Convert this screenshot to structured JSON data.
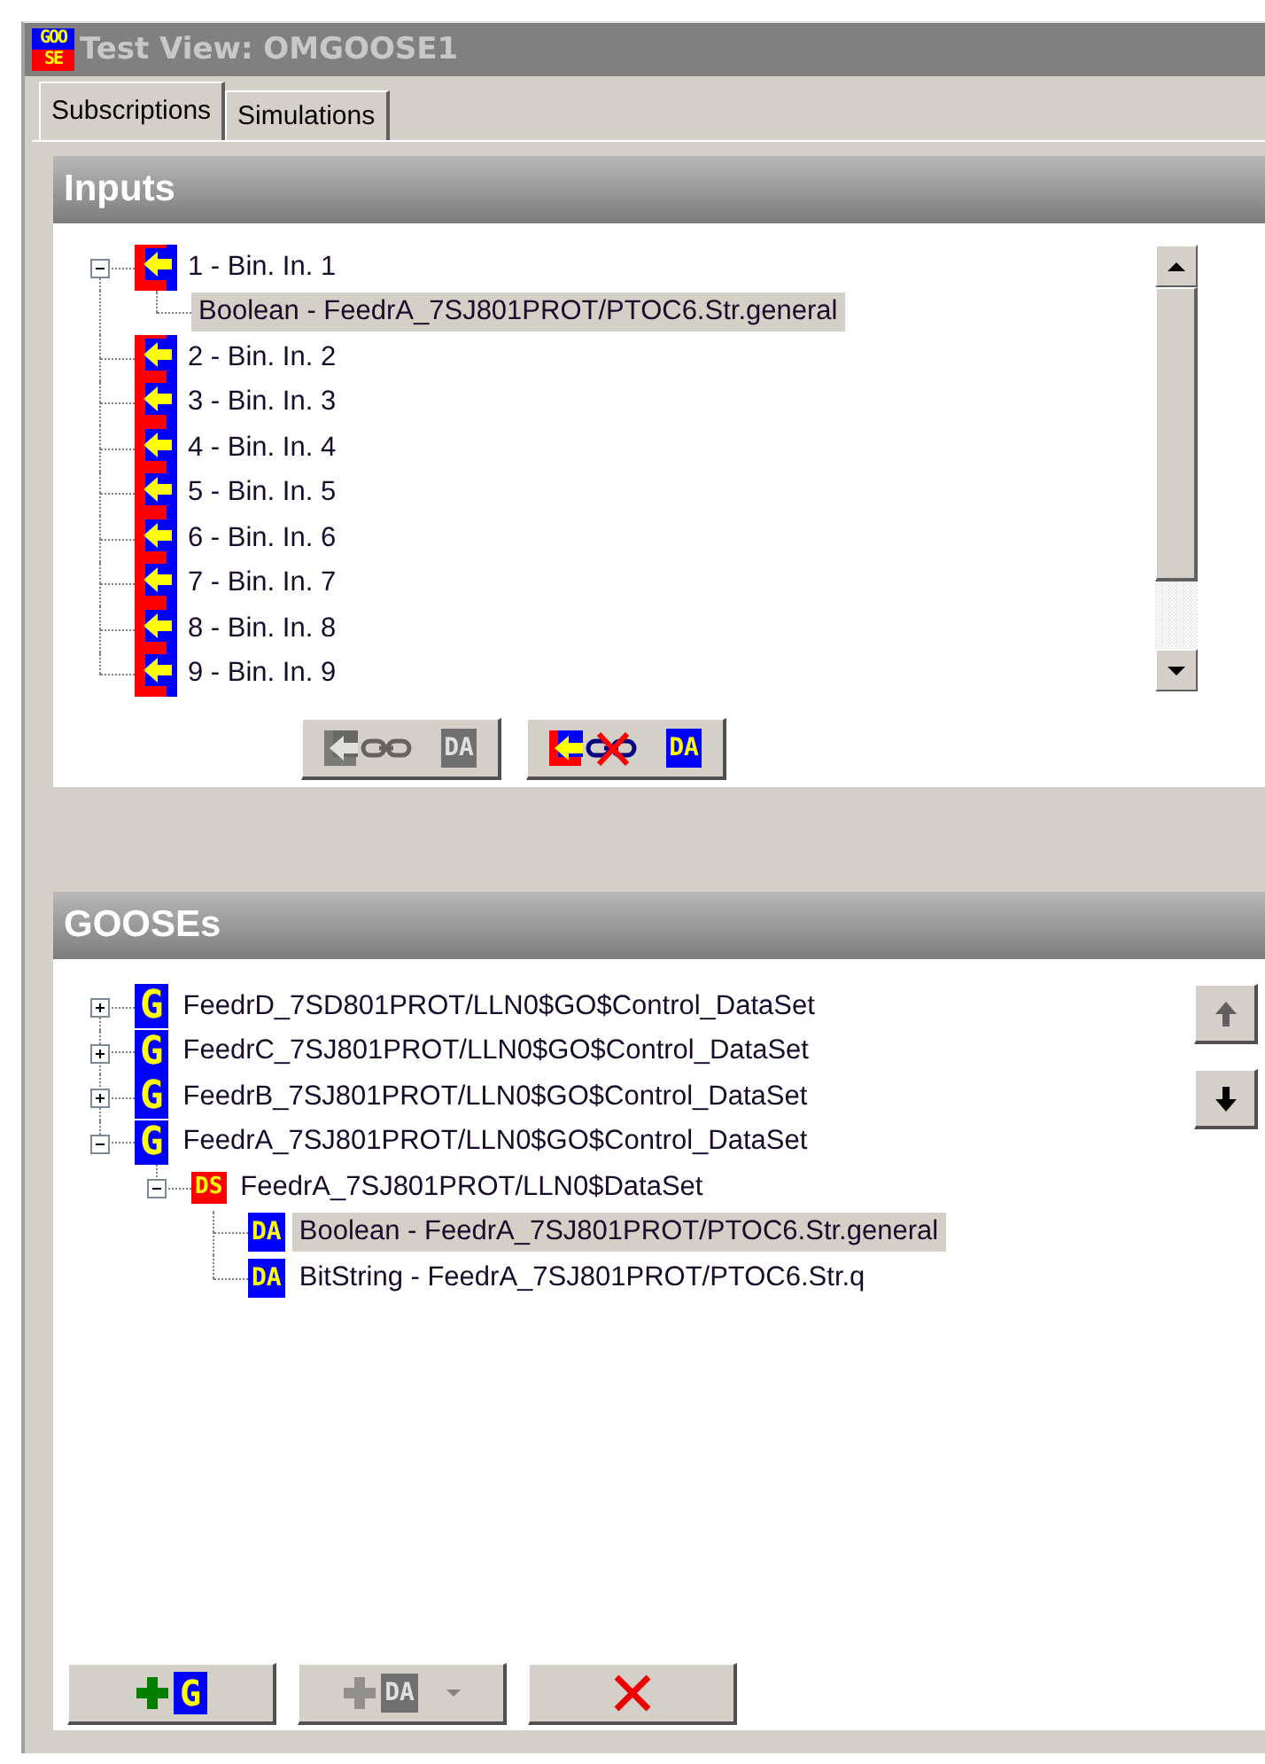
{
  "window": {
    "title": "Test View: OMGOOSE1",
    "app_icon": [
      "GOO",
      "SE"
    ]
  },
  "tabs": [
    {
      "label": "Subscriptions",
      "selected": true
    },
    {
      "label": "Simulations",
      "selected": false
    }
  ],
  "inputs": {
    "title": "Inputs",
    "tree": [
      {
        "kind": "input",
        "label": "1 - Bin. In. 1",
        "expanded": true,
        "selected": false,
        "children": [
          {
            "label": "Boolean - FeedrA_7SJ801PROT/PTOC6.Str.general",
            "selected": true
          }
        ]
      },
      {
        "kind": "input",
        "label": "2 - Bin. In. 2",
        "selected": false
      },
      {
        "kind": "input",
        "label": "3 - Bin. In. 3",
        "selected": false
      },
      {
        "kind": "input",
        "label": "4 - Bin. In. 4",
        "selected": false
      },
      {
        "kind": "input",
        "label": "5 - Bin. In. 5",
        "selected": false
      },
      {
        "kind": "input",
        "label": "6 - Bin. In. 6",
        "selected": false
      },
      {
        "kind": "input",
        "label": "7 - Bin. In. 7",
        "selected": false
      },
      {
        "kind": "input",
        "label": "8 - Bin. In. 8",
        "selected": false
      },
      {
        "kind": "input",
        "label": "9 - Bin. In. 9",
        "selected": false
      }
    ],
    "buttons": [
      {
        "kind": "link",
        "badge": "DA",
        "disabled": true
      },
      {
        "kind": "unlink",
        "badge": "DA",
        "disabled": false
      }
    ]
  },
  "gooses": {
    "title": "GOOSEs",
    "tree": [
      {
        "kind": "goose",
        "badge": "G",
        "label": "FeedrD_7SD801PROT/LLN0$GO$Control_DataSet",
        "expanded": false,
        "selected": false
      },
      {
        "kind": "goose",
        "badge": "G",
        "label": "FeedrC_7SJ801PROT/LLN0$GO$Control_DataSet",
        "expanded": false,
        "selected": false
      },
      {
        "kind": "goose",
        "badge": "G",
        "label": "FeedrB_7SJ801PROT/LLN0$GO$Control_DataSet",
        "expanded": false,
        "selected": false
      },
      {
        "kind": "goose",
        "badge": "G",
        "label": "FeedrA_7SJ801PROT/LLN0$GO$Control_DataSet",
        "expanded": true,
        "selected": false,
        "children": [
          {
            "kind": "dataset",
            "badge": "DS",
            "label": "FeedrA_7SJ801PROT/LLN0$DataSet",
            "expanded": true,
            "selected": false,
            "children": [
              {
                "kind": "attribute",
                "badge": "DA",
                "label": "Boolean - FeedrA_7SJ801PROT/PTOC6.Str.general",
                "selected": true
              },
              {
                "kind": "attribute",
                "badge": "DA",
                "label": "BitString - FeedrA_7SJ801PROT/PTOC6.Str.q",
                "selected": false
              }
            ]
          }
        ]
      }
    ],
    "move_buttons": [
      {
        "kind": "up",
        "disabled": true
      },
      {
        "kind": "down",
        "disabled": false
      }
    ],
    "buttons": [
      {
        "kind": "add_goose",
        "badge": "G",
        "disabled": false
      },
      {
        "kind": "add_da",
        "badge": "DA",
        "disabled": true
      },
      {
        "kind": "delete",
        "disabled": false
      }
    ]
  }
}
